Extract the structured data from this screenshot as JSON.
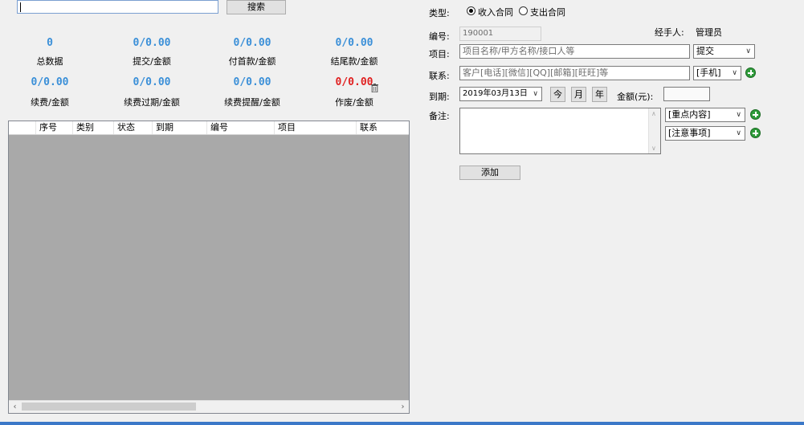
{
  "search": {
    "value": "",
    "button_label": "搜索"
  },
  "stats": [
    {
      "value": "0",
      "label": "总数据"
    },
    {
      "value": "0/0.00",
      "label": "提交/金额"
    },
    {
      "value": "0/0.00",
      "label": "付首款/金额"
    },
    {
      "value": "0/0.00",
      "label": "结尾款/金额"
    },
    {
      "value": "0/0.00",
      "label": "续费/金额"
    },
    {
      "value": "0/0.00",
      "label": "续费过期/金额"
    },
    {
      "value": "0/0.00",
      "label": "续费提醒/金额"
    },
    {
      "value": "0/0.00",
      "label": "作废/金额"
    }
  ],
  "colors": {
    "stat_value": "#3a8fd8",
    "void_value": "#e02020",
    "accent_bar": "#3b78c8",
    "grid_bg": "#a9a9a9"
  },
  "table": {
    "columns": [
      "序号",
      "类别",
      "状态",
      "到期",
      "编号",
      "项目",
      "联系"
    ]
  },
  "form": {
    "type_label": "类型:",
    "type_options": [
      "收入合同",
      "支出合同"
    ],
    "handler_label": "经手人:",
    "handler_value": "管理员",
    "number_label": "编号:",
    "number_value": "190001",
    "project_label": "项目:",
    "project_placeholder": "项目名称/甲方名称/接口人等",
    "project_status": "提交",
    "contact_label": "联系:",
    "contact_placeholder": "客户[电话][微信][QQ][邮箱][旺旺]等",
    "contact_type": "[手机]",
    "due_label": "到期:",
    "due_value": "2019年03月13日",
    "today_button": "今",
    "month_button": "月",
    "year_button": "年",
    "amount_label": "金额(元):",
    "amount_value": "",
    "remarks_label": "备注:",
    "remarks_value": "",
    "key_content": "[重点内容]",
    "notes": "[注意事项]",
    "add_button": "添加"
  }
}
